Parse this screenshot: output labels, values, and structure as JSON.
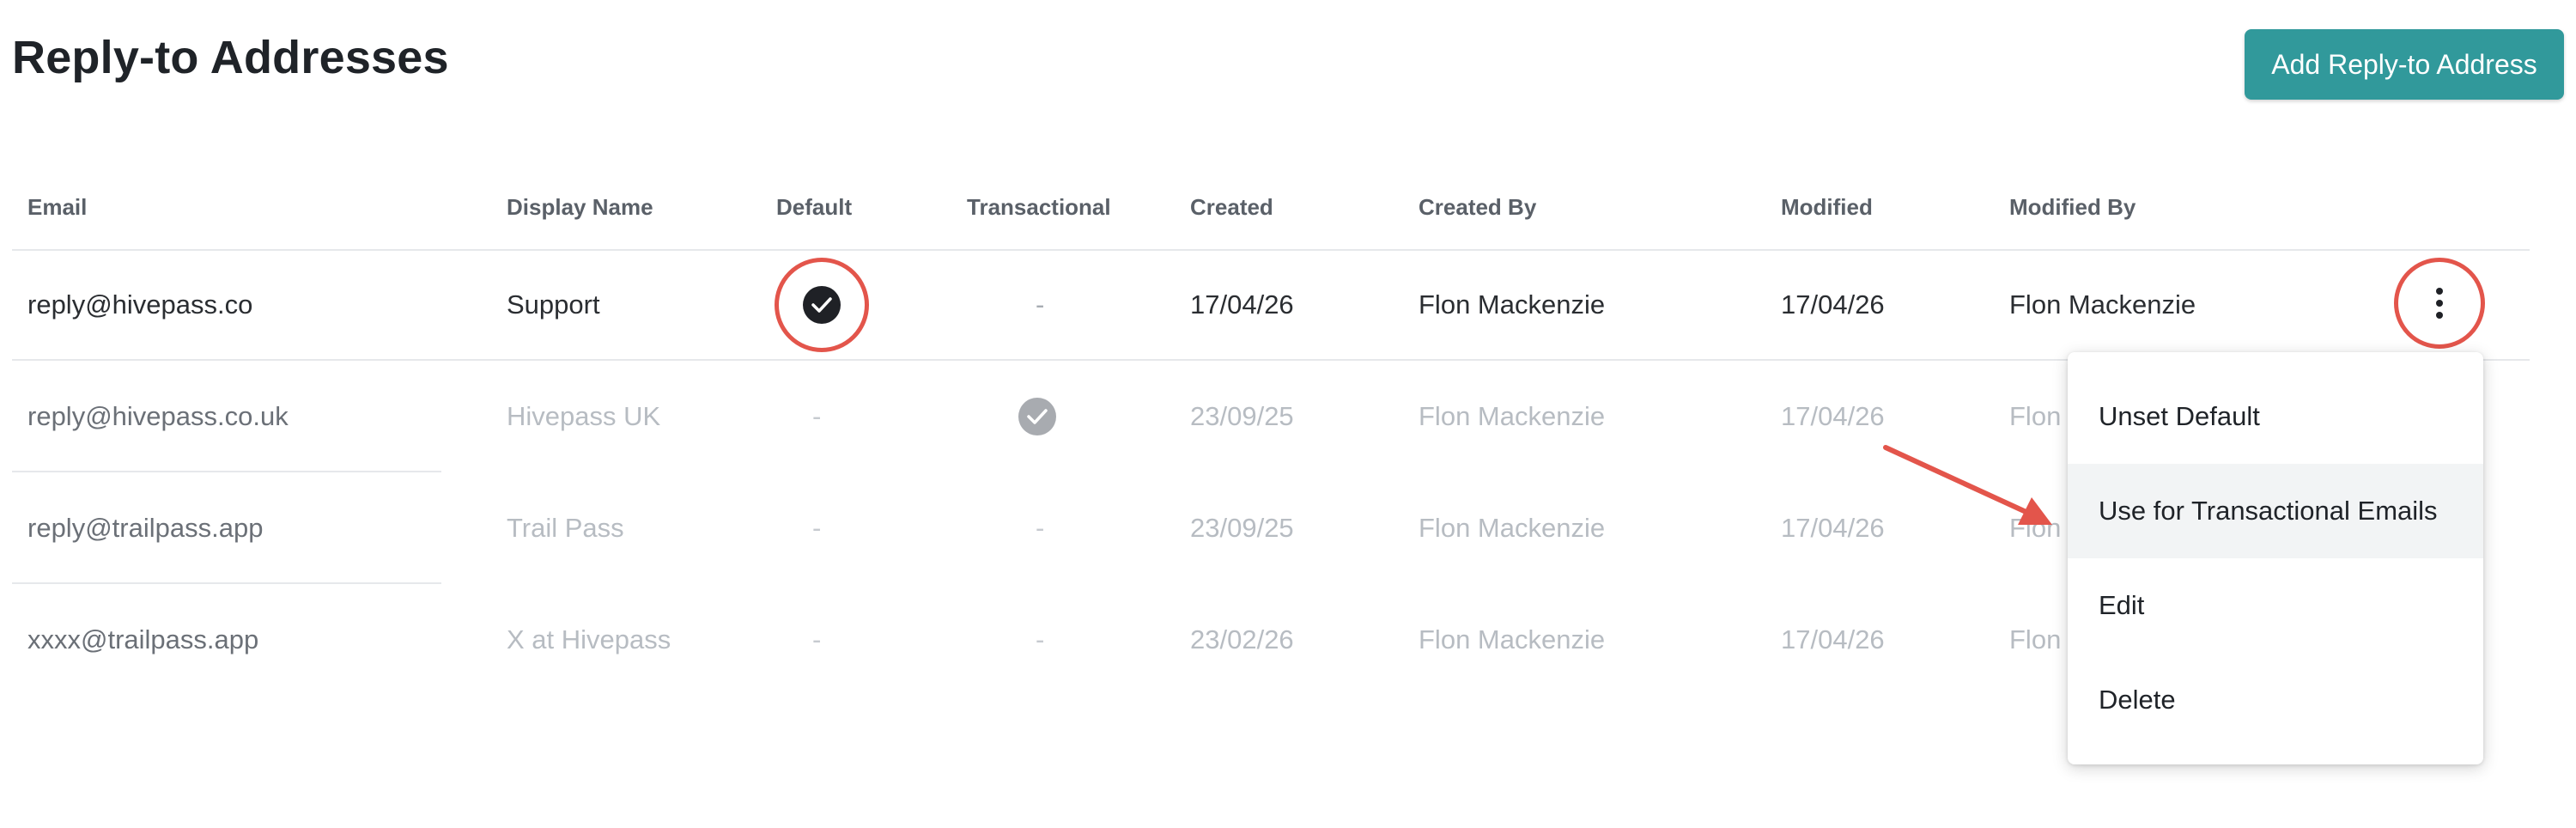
{
  "page": {
    "title": "Reply-to Addresses",
    "add_button_label": "Add Reply-to Address"
  },
  "table": {
    "columns": [
      "Email",
      "Display Name",
      "Default",
      "Transactional",
      "Created",
      "Created By",
      "Modified",
      "Modified By"
    ],
    "rows": [
      {
        "email": "reply@hivepass.co",
        "display_name": "Support",
        "default": true,
        "transactional": "-",
        "created": "17/04/26",
        "created_by": "Flon Mackenzie",
        "modified": "17/04/26",
        "modified_by": "Flon Mackenzie"
      },
      {
        "email": "reply@hivepass.co.uk",
        "display_name": "Hivepass UK",
        "default": "-",
        "transactional": true,
        "created": "23/09/25",
        "created_by": "Flon Mackenzie",
        "modified": "17/04/26",
        "modified_by": "Flon"
      },
      {
        "email": "reply@trailpass.app",
        "display_name": "Trail Pass",
        "default": "-",
        "transactional": "-",
        "created": "23/09/25",
        "created_by": "Flon Mackenzie",
        "modified": "17/04/26",
        "modified_by": "Flon"
      },
      {
        "email": "xxxx@trailpass.app",
        "display_name": "X at Hivepass",
        "default": "-",
        "transactional": "-",
        "created": "23/02/26",
        "created_by": "Flon Mackenzie",
        "modified": "17/04/26",
        "modified_by": "Flon"
      }
    ]
  },
  "row_menu": {
    "items": [
      "Unset Default",
      "Use for Transactional Emails",
      "Edit",
      "Delete"
    ],
    "highlighted_item": "Use for Transactional Emails"
  },
  "icons": {
    "default_check": "check-circle-icon",
    "transactional_check": "check-circle-icon",
    "row_actions": "more-vertical-icon",
    "annotation_arrow": "arrow-right-icon"
  },
  "colors": {
    "accent": "#31999b",
    "annotation": "#e3554b",
    "check_active": "#1f2126",
    "check_inactive": "#a8abb0"
  }
}
